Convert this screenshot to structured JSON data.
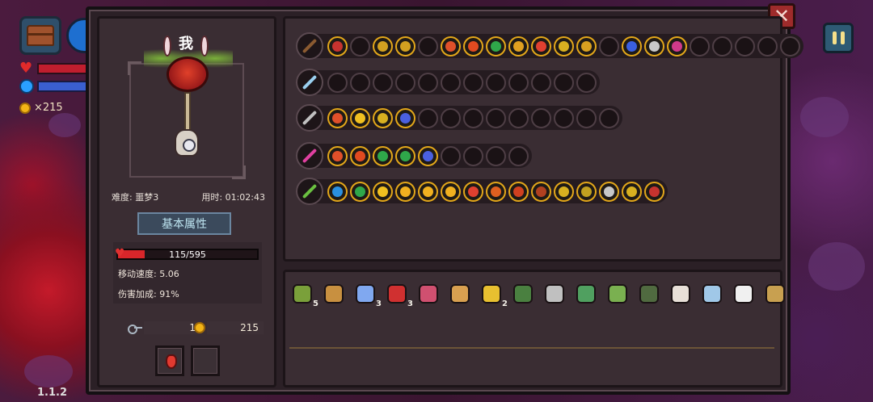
{
  "hud": {
    "coins": "×215",
    "version": "1.1.2"
  },
  "panel": {
    "close_label": "✕",
    "character": {
      "name": "我",
      "difficulty": "难度: 噩梦3",
      "time": "用时: 01:02:43"
    },
    "attributes": {
      "title": "基本属性",
      "hp_text": "115/595",
      "hp_fraction": 0.193,
      "move_speed": "移动速度: 5.06",
      "damage_bonus": "伤害加成: 91%"
    },
    "resources": {
      "keys": "1",
      "coins": "215"
    }
  },
  "weapon_rows": [
    {
      "weapon": "chest-weapon",
      "color": "#8a5a30",
      "slots": [
        "#c6332f",
        "",
        "#d2a020",
        "#d2a020",
        "",
        "#e0502a",
        "#e04a20",
        "#2fa84a",
        "#e0a020",
        "#e04030",
        "#d8b020",
        "#d8a020",
        "",
        "#3a5fe0",
        "#c8c8c8",
        "#d03a8a",
        "",
        "",
        "",
        "",
        ""
      ]
    },
    {
      "weapon": "blade-weapon",
      "color": "#9ad0f0",
      "slots": [
        "",
        "",
        "",
        "",
        "",
        "",
        "",
        "",
        "",
        "",
        "",
        ""
      ]
    },
    {
      "weapon": "spear-weapon",
      "color": "#c0c0c0",
      "slots": [
        "#e0502a",
        "#f0c020",
        "#d8b020",
        "#4a60e0",
        "",
        "",
        "",
        "",
        "",
        "",
        "",
        "",
        ""
      ]
    },
    {
      "weapon": "staff-weapon",
      "color": "#e040a0",
      "slots": [
        "#e0502a",
        "#e04a20",
        "#2fa84a",
        "#2fa84a",
        "#4a60e0",
        "",
        "",
        "",
        ""
      ]
    },
    {
      "weapon": "trident-weapon",
      "color": "#6ac040",
      "slots": [
        "#2a90e0",
        "#2fa84a",
        "#f0c020",
        "#f0b020",
        "#f0b020",
        "#f0b020",
        "#e04030",
        "#e06020",
        "#d04020",
        "#b04020",
        "#d8b020",
        "#c0a020",
        "#c8c8c8",
        "#d8b020",
        "#c6332f"
      ]
    }
  ],
  "inventory": [
    {
      "name": "claw-item",
      "color": "#7aa03a",
      "count": "5"
    },
    {
      "name": "pickaxe-item",
      "color": "#c89040",
      "count": ""
    },
    {
      "name": "egg-item",
      "color": "#80a8f0",
      "count": "3"
    },
    {
      "name": "demon-item",
      "color": "#d03030",
      "count": "3"
    },
    {
      "name": "sack-item",
      "color": "#d05070",
      "count": ""
    },
    {
      "name": "hourglass-item",
      "color": "#d8a050",
      "count": ""
    },
    {
      "name": "cheese-item",
      "color": "#e8c030",
      "count": "2"
    },
    {
      "name": "boot-item",
      "color": "#4a8040",
      "count": ""
    },
    {
      "name": "bow-item",
      "color": "#c0c0c0",
      "count": ""
    },
    {
      "name": "plant-item",
      "color": "#50a060",
      "count": ""
    },
    {
      "name": "herb-item",
      "color": "#7ab050",
      "count": ""
    },
    {
      "name": "cloak-item",
      "color": "#506a40",
      "count": ""
    },
    {
      "name": "feather-item",
      "color": "#e8e0d8",
      "count": ""
    },
    {
      "name": "magnifier-item",
      "color": "#a0c8e8",
      "count": ""
    },
    {
      "name": "jaw-item",
      "color": "#f0f0f0",
      "count": ""
    },
    {
      "name": "lantern-item",
      "color": "#c8a050",
      "count": ""
    }
  ]
}
